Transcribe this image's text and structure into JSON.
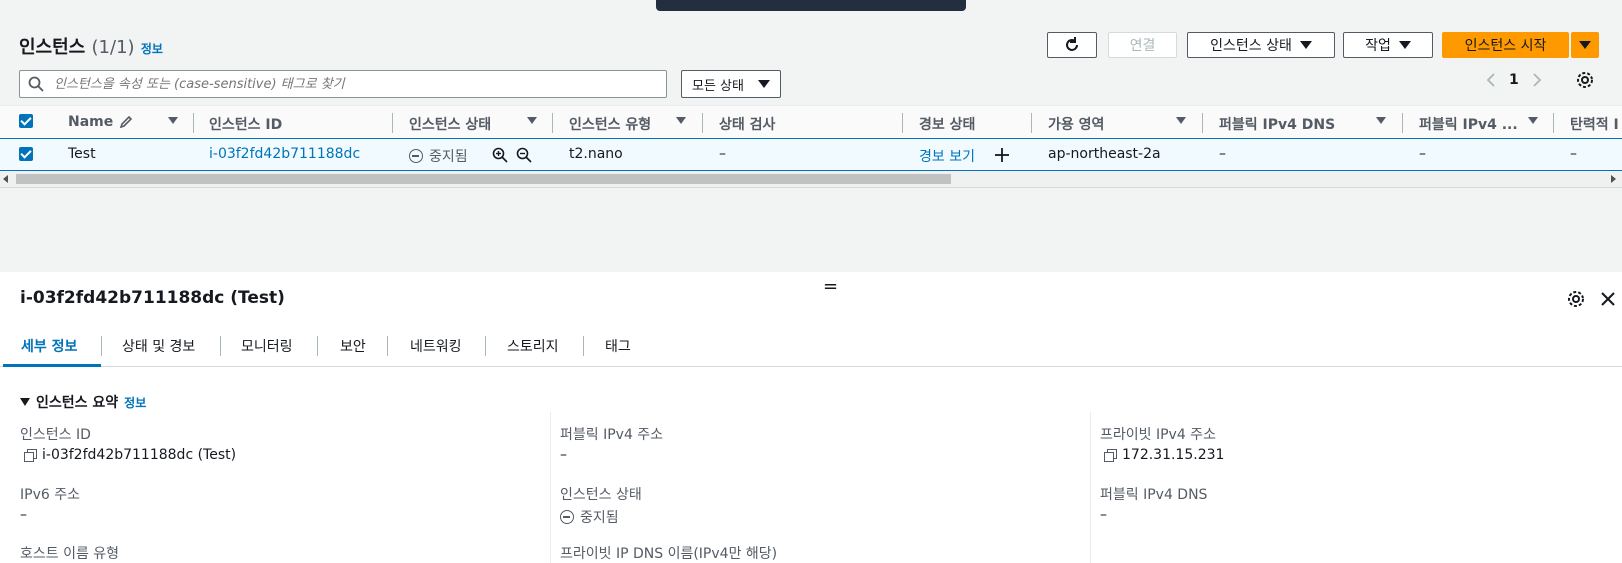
{
  "header": {
    "title": "인스턴스",
    "count": "(1/1)",
    "info_label": "정보",
    "refresh_label": "",
    "connect_label": "연결",
    "instance_state_label": "인스턴스 상태",
    "actions_label": "작업",
    "launch_label": "인스턴스 시작"
  },
  "search": {
    "placeholder": "인스턴스을 속성 또는 (case-sensitive) 태그로 찾기",
    "state_filter": "모든 상태"
  },
  "pagination": {
    "page": "1"
  },
  "table": {
    "columns": [
      "Name",
      "인스턴스 ID",
      "인스턴스 상태",
      "인스턴스 유형",
      "상태 검사",
      "경보 상태",
      "가용 영역",
      "퍼블릭 IPv4 DNS",
      "퍼블릭 IPv4 ...",
      "탄력적 I"
    ],
    "row": {
      "name": "Test",
      "instance_id": "i-03f2fd42b711188dc",
      "state": "중지됨",
      "type": "t2.nano",
      "status_check": "–",
      "alarm": "경보 보기",
      "az": "ap-northeast-2a",
      "public_dns": "–",
      "public_ipv4": "–",
      "elastic_ip": "–"
    }
  },
  "detail": {
    "title": "i-03f2fd42b711188dc (Test)",
    "tabs": [
      "세부 정보",
      "상태 및 경보",
      "모니터링",
      "보안",
      "네트워킹",
      "스토리지",
      "태그"
    ],
    "section_title": "인스턴스 요약",
    "section_info": "정보",
    "fields": {
      "instance_id_label": "인스턴스 ID",
      "instance_id_value": "i-03f2fd42b711188dc (Test)",
      "public_ipv4_label": "퍼블릭 IPv4 주소",
      "public_ipv4_value": "–",
      "private_ipv4_label": "프라이빗 IPv4 주소",
      "private_ipv4_value": "172.31.15.231",
      "ipv6_label": "IPv6 주소",
      "ipv6_value": "–",
      "state_label": "인스턴스 상태",
      "state_value": "중지됨",
      "public_dns_label": "퍼블릭 IPv4 DNS",
      "public_dns_value": "–",
      "hostname_type_label": "호스트 이름 유형",
      "private_dns_label": "프라이빗 IP DNS 이름(IPv4만 해당)"
    }
  },
  "colors": {
    "accent": "#0073bb",
    "primary": "#ff9900"
  }
}
